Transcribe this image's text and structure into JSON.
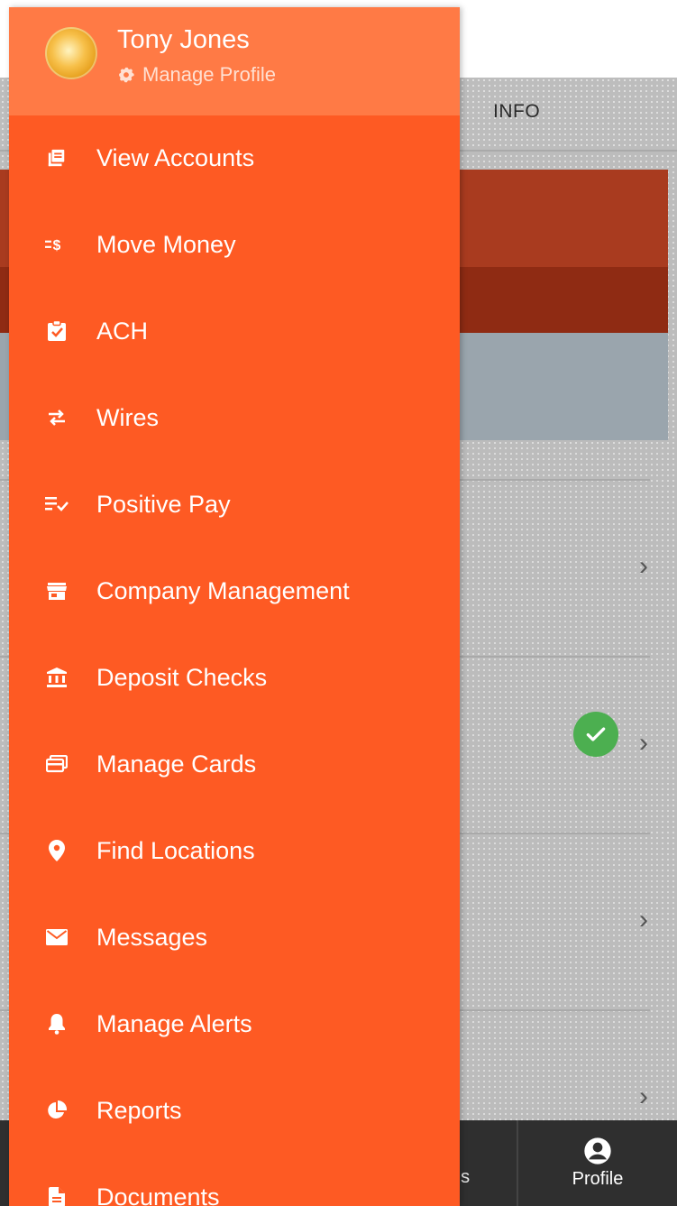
{
  "user": {
    "name": "Tony Jones",
    "manage_profile_label": "Manage Profile"
  },
  "menu": {
    "items": [
      {
        "label": "View Accounts",
        "icon": "view-accounts-icon"
      },
      {
        "label": "Move Money",
        "icon": "move-money-icon"
      },
      {
        "label": "ACH",
        "icon": "clipboard-check-icon"
      },
      {
        "label": "Wires",
        "icon": "swap-arrows-icon"
      },
      {
        "label": "Positive Pay",
        "icon": "list-check-icon"
      },
      {
        "label": "Company Management",
        "icon": "store-icon"
      },
      {
        "label": "Deposit Checks",
        "icon": "bank-icon"
      },
      {
        "label": "Manage Cards",
        "icon": "cards-icon"
      },
      {
        "label": "Find Locations",
        "icon": "location-pin-icon"
      },
      {
        "label": "Messages",
        "icon": "envelope-icon"
      },
      {
        "label": "Manage Alerts",
        "icon": "bell-icon"
      },
      {
        "label": "Reports",
        "icon": "pie-chart-icon"
      },
      {
        "label": "Documents",
        "icon": "document-icon"
      }
    ]
  },
  "background": {
    "tab_info": "INFO",
    "bottom_nav": {
      "partial_label": "ns",
      "profile_label": "Profile"
    }
  },
  "colors": {
    "drawer": "#fe5a23",
    "drawer_header": "#ff7a45",
    "check_badge": "#4caf50",
    "bottom_nav": "#2f2f2f"
  }
}
